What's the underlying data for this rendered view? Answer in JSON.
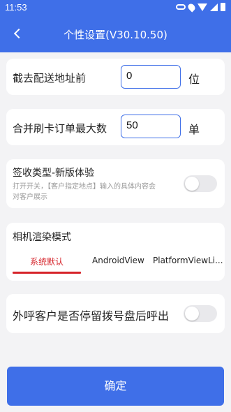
{
  "status_bar": {
    "time": "11:53",
    "icons": [
      "key-icon",
      "location-icon",
      "wifi-icon",
      "signal-icon",
      "battery-icon"
    ]
  },
  "header": {
    "title": "个性设置(V30.10.50)",
    "back_icon": "chevron-left-icon",
    "bg_color": "#3f6fe8"
  },
  "settings": {
    "truncate_address": {
      "label": "截去配送地址前",
      "value": "0",
      "unit": "位"
    },
    "merge_orders": {
      "label": "合并刷卡订单最大数",
      "value": "50",
      "unit": "单"
    },
    "sign_type": {
      "title": "签收类型-新版体验",
      "description": "打开开关，【客户指定地点】输入的具体内容会对客户展示",
      "enabled": false
    },
    "camera_render": {
      "title": "相机渲染模式",
      "tabs": [
        "系统默认",
        "AndroidView",
        "PlatformViewLi..."
      ],
      "active_tab": 0
    },
    "outbound_call": {
      "label": "外呼客户是否停留拨号盘后呼出",
      "enabled": false
    }
  },
  "confirm_label": "确定",
  "accent_color": "#3f6fe8",
  "active_tab_color": "#d6232a"
}
